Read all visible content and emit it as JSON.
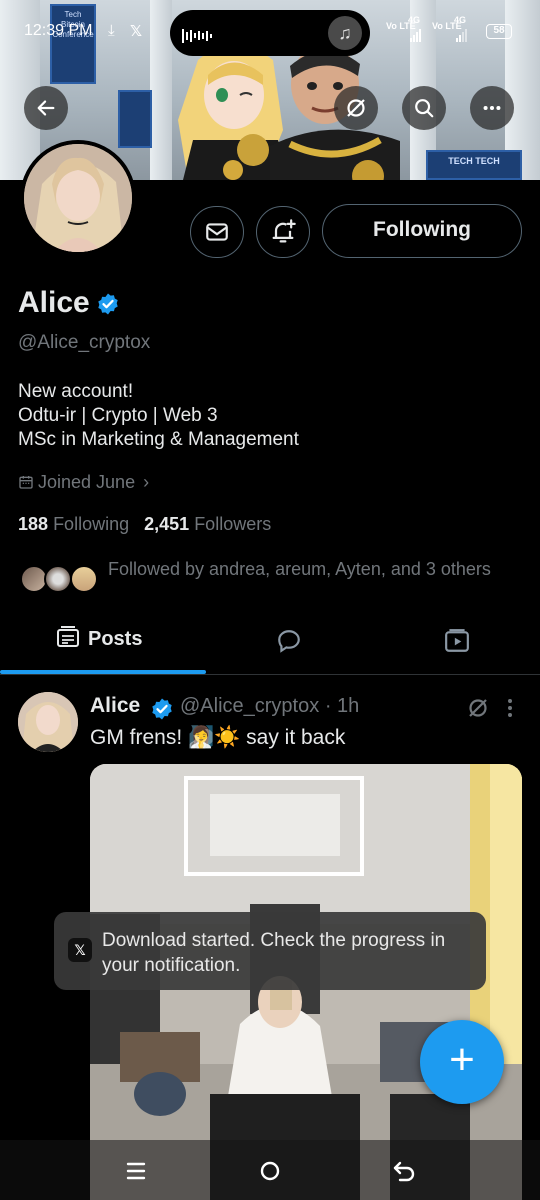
{
  "status_bar": {
    "time": "12:39 PM",
    "network_1": "Vo LTE",
    "network_1_type": "4G",
    "network_2": "Vo LTE",
    "network_2_type": "4G",
    "battery": "58"
  },
  "banner": {
    "poster_left": "Tech Bitcoin Conference",
    "poster_right": "TECH TECH"
  },
  "profile": {
    "follow_button": "Following",
    "name": "Alice",
    "handle": "@Alice_cryptox",
    "bio": [
      "New account!",
      "Odtu-ir | Crypto | Web 3",
      "MSc in Marketing & Management"
    ],
    "joined": "Joined June",
    "following_count": "188",
    "following_label": "Following",
    "followers_count": "2,451",
    "followers_label": "Followers",
    "followed_by": "Followed by andrea, areum, Ayten, and 3 others"
  },
  "tabs": {
    "posts": "Posts"
  },
  "post": {
    "name": "Alice",
    "handle": "@Alice_cryptox",
    "separator": "·",
    "time": "1h",
    "text": "GM frens! 🧖‍♀️☀️ say it back"
  },
  "toast": {
    "text": "Download started. Check the progress in your notification."
  },
  "colors": {
    "accent": "#1d9bf0",
    "background": "#000000",
    "secondary_text": "#71767b"
  }
}
